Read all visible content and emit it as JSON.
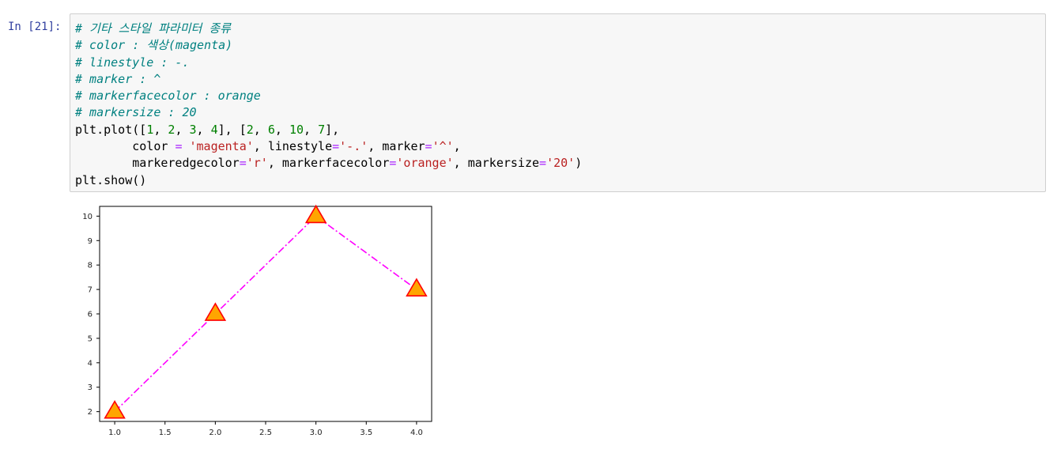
{
  "cell": {
    "prompt": "In [21]:",
    "lines": [
      [
        {
          "t": "# 기타 스타일 파라미터 종류",
          "c": "cm"
        }
      ],
      [
        {
          "t": "# color : 색상(magenta)",
          "c": "cm"
        }
      ],
      [
        {
          "t": "# linestyle : -.",
          "c": "cm"
        }
      ],
      [
        {
          "t": "# marker : ^",
          "c": "cm"
        }
      ],
      [
        {
          "t": "# markerfacecolor : orange",
          "c": "cm"
        }
      ],
      [
        {
          "t": "# markersize : 20",
          "c": "cm"
        }
      ],
      [
        {
          "t": "plt.plot([",
          "c": ""
        },
        {
          "t": "1",
          "c": "num"
        },
        {
          "t": ", ",
          "c": ""
        },
        {
          "t": "2",
          "c": "num"
        },
        {
          "t": ", ",
          "c": ""
        },
        {
          "t": "3",
          "c": "num"
        },
        {
          "t": ", ",
          "c": ""
        },
        {
          "t": "4",
          "c": "num"
        },
        {
          "t": "], [",
          "c": ""
        },
        {
          "t": "2",
          "c": "num"
        },
        {
          "t": ", ",
          "c": ""
        },
        {
          "t": "6",
          "c": "num"
        },
        {
          "t": ", ",
          "c": ""
        },
        {
          "t": "10",
          "c": "num"
        },
        {
          "t": ", ",
          "c": ""
        },
        {
          "t": "7",
          "c": "num"
        },
        {
          "t": "],",
          "c": ""
        }
      ],
      [
        {
          "t": "        color ",
          "c": ""
        },
        {
          "t": "=",
          "c": "op"
        },
        {
          "t": " ",
          "c": ""
        },
        {
          "t": "'magenta'",
          "c": "str"
        },
        {
          "t": ", linestyle",
          "c": ""
        },
        {
          "t": "=",
          "c": "op"
        },
        {
          "t": "'-.'",
          "c": "str"
        },
        {
          "t": ", marker",
          "c": ""
        },
        {
          "t": "=",
          "c": "op"
        },
        {
          "t": "'^'",
          "c": "str"
        },
        {
          "t": ",",
          "c": ""
        }
      ],
      [
        {
          "t": "        markeredgecolor",
          "c": ""
        },
        {
          "t": "=",
          "c": "op"
        },
        {
          "t": "'r'",
          "c": "str"
        },
        {
          "t": ", markerfacecolor",
          "c": ""
        },
        {
          "t": "=",
          "c": "op"
        },
        {
          "t": "'orange'",
          "c": "str"
        },
        {
          "t": ", markersize",
          "c": ""
        },
        {
          "t": "=",
          "c": "op"
        },
        {
          "t": "'20'",
          "c": "str"
        },
        {
          "t": ")",
          "c": ""
        }
      ],
      [
        {
          "t": "plt.show()",
          "c": ""
        }
      ]
    ]
  },
  "chart_data": {
    "type": "line",
    "x": [
      1,
      2,
      3,
      4
    ],
    "y": [
      2,
      6,
      10,
      7
    ],
    "xticks": [
      "1.0",
      "1.5",
      "2.0",
      "2.5",
      "3.0",
      "3.5",
      "4.0"
    ],
    "yticks": [
      "2",
      "3",
      "4",
      "5",
      "6",
      "7",
      "8",
      "9",
      "10"
    ],
    "xlim": [
      0.85,
      4.15
    ],
    "ylim": [
      1.6,
      10.4
    ],
    "line_color": "#ff00ff",
    "linestyle": "-.",
    "marker": "triangle",
    "marker_face_color": "#ffa500",
    "marker_edge_color": "#ff0000",
    "title": "",
    "xlabel": "",
    "ylabel": "",
    "grid": false
  }
}
